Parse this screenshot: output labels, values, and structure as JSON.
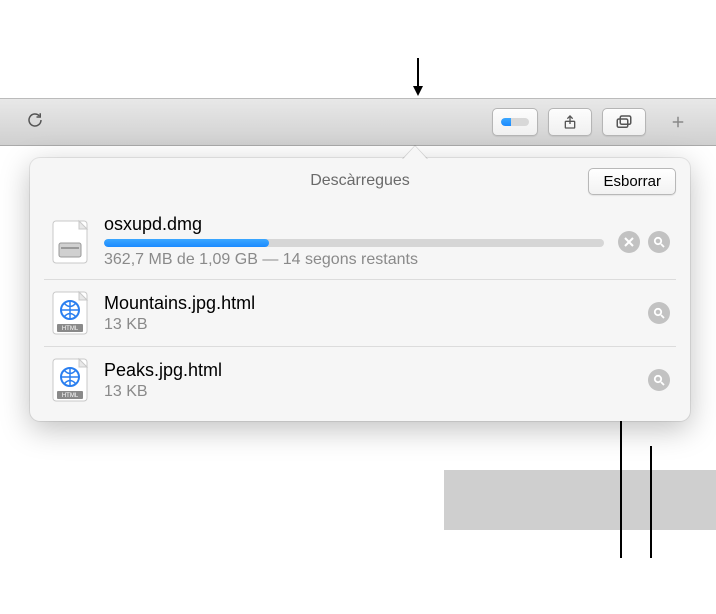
{
  "toolbar": {
    "refresh": "Refresh",
    "downloads": "Downloads",
    "share": "Share",
    "tabs": "Tabs",
    "new_tab": "New Tab",
    "mini_progress_percent": 35
  },
  "popover": {
    "title": "Descàrregues",
    "clear_label": "Esborrar"
  },
  "downloads": [
    {
      "name": "osxupd.dmg",
      "meta": "362,7 MB de 1,09 GB — 14 segons restants",
      "progress_percent": 33,
      "in_progress": true,
      "icon": "dmg"
    },
    {
      "name": "Mountains.jpg.html",
      "meta": "13 KB",
      "in_progress": false,
      "icon": "html"
    },
    {
      "name": "Peaks.jpg.html",
      "meta": "13 KB",
      "in_progress": false,
      "icon": "html"
    }
  ]
}
